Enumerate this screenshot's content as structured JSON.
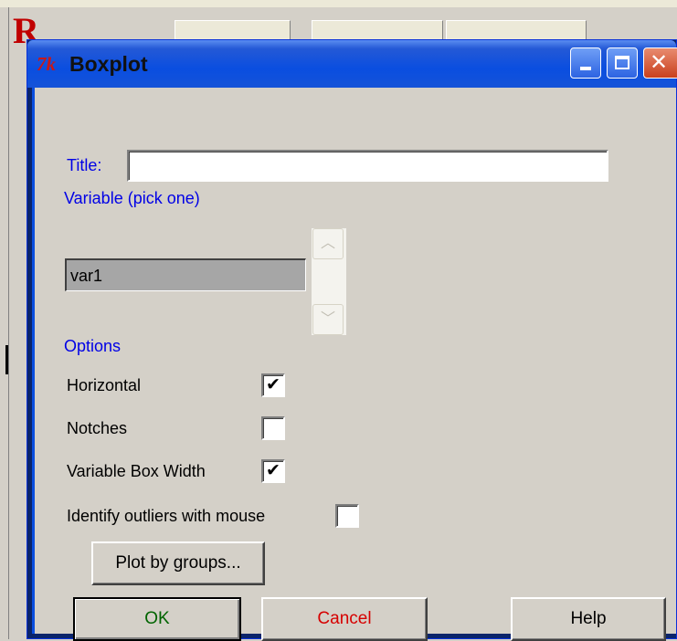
{
  "window": {
    "title": "Boxplot",
    "app_icon_text": "7k"
  },
  "background": {
    "logo_text": "R"
  },
  "form": {
    "title_label": "Title:",
    "title_value": "",
    "variable_label": "Variable (pick one)",
    "variables": [
      "var1"
    ],
    "options_label": "Options",
    "options": [
      {
        "label": "Horizontal",
        "checked": true
      },
      {
        "label": "Notches",
        "checked": false
      },
      {
        "label": "Variable Box Width",
        "checked": true
      },
      {
        "label": "Identify outliers with mouse",
        "checked": false
      }
    ],
    "checkmark_glyph": "✔"
  },
  "buttons": {
    "plot_by_groups": "Plot by groups...",
    "ok": "OK",
    "cancel": "Cancel",
    "help": "Help"
  },
  "colors": {
    "label_blue": "#0000e6",
    "ok_green": "#006400",
    "cancel_red": "#d60000",
    "titlebar_blue": "#0a4ee0"
  }
}
